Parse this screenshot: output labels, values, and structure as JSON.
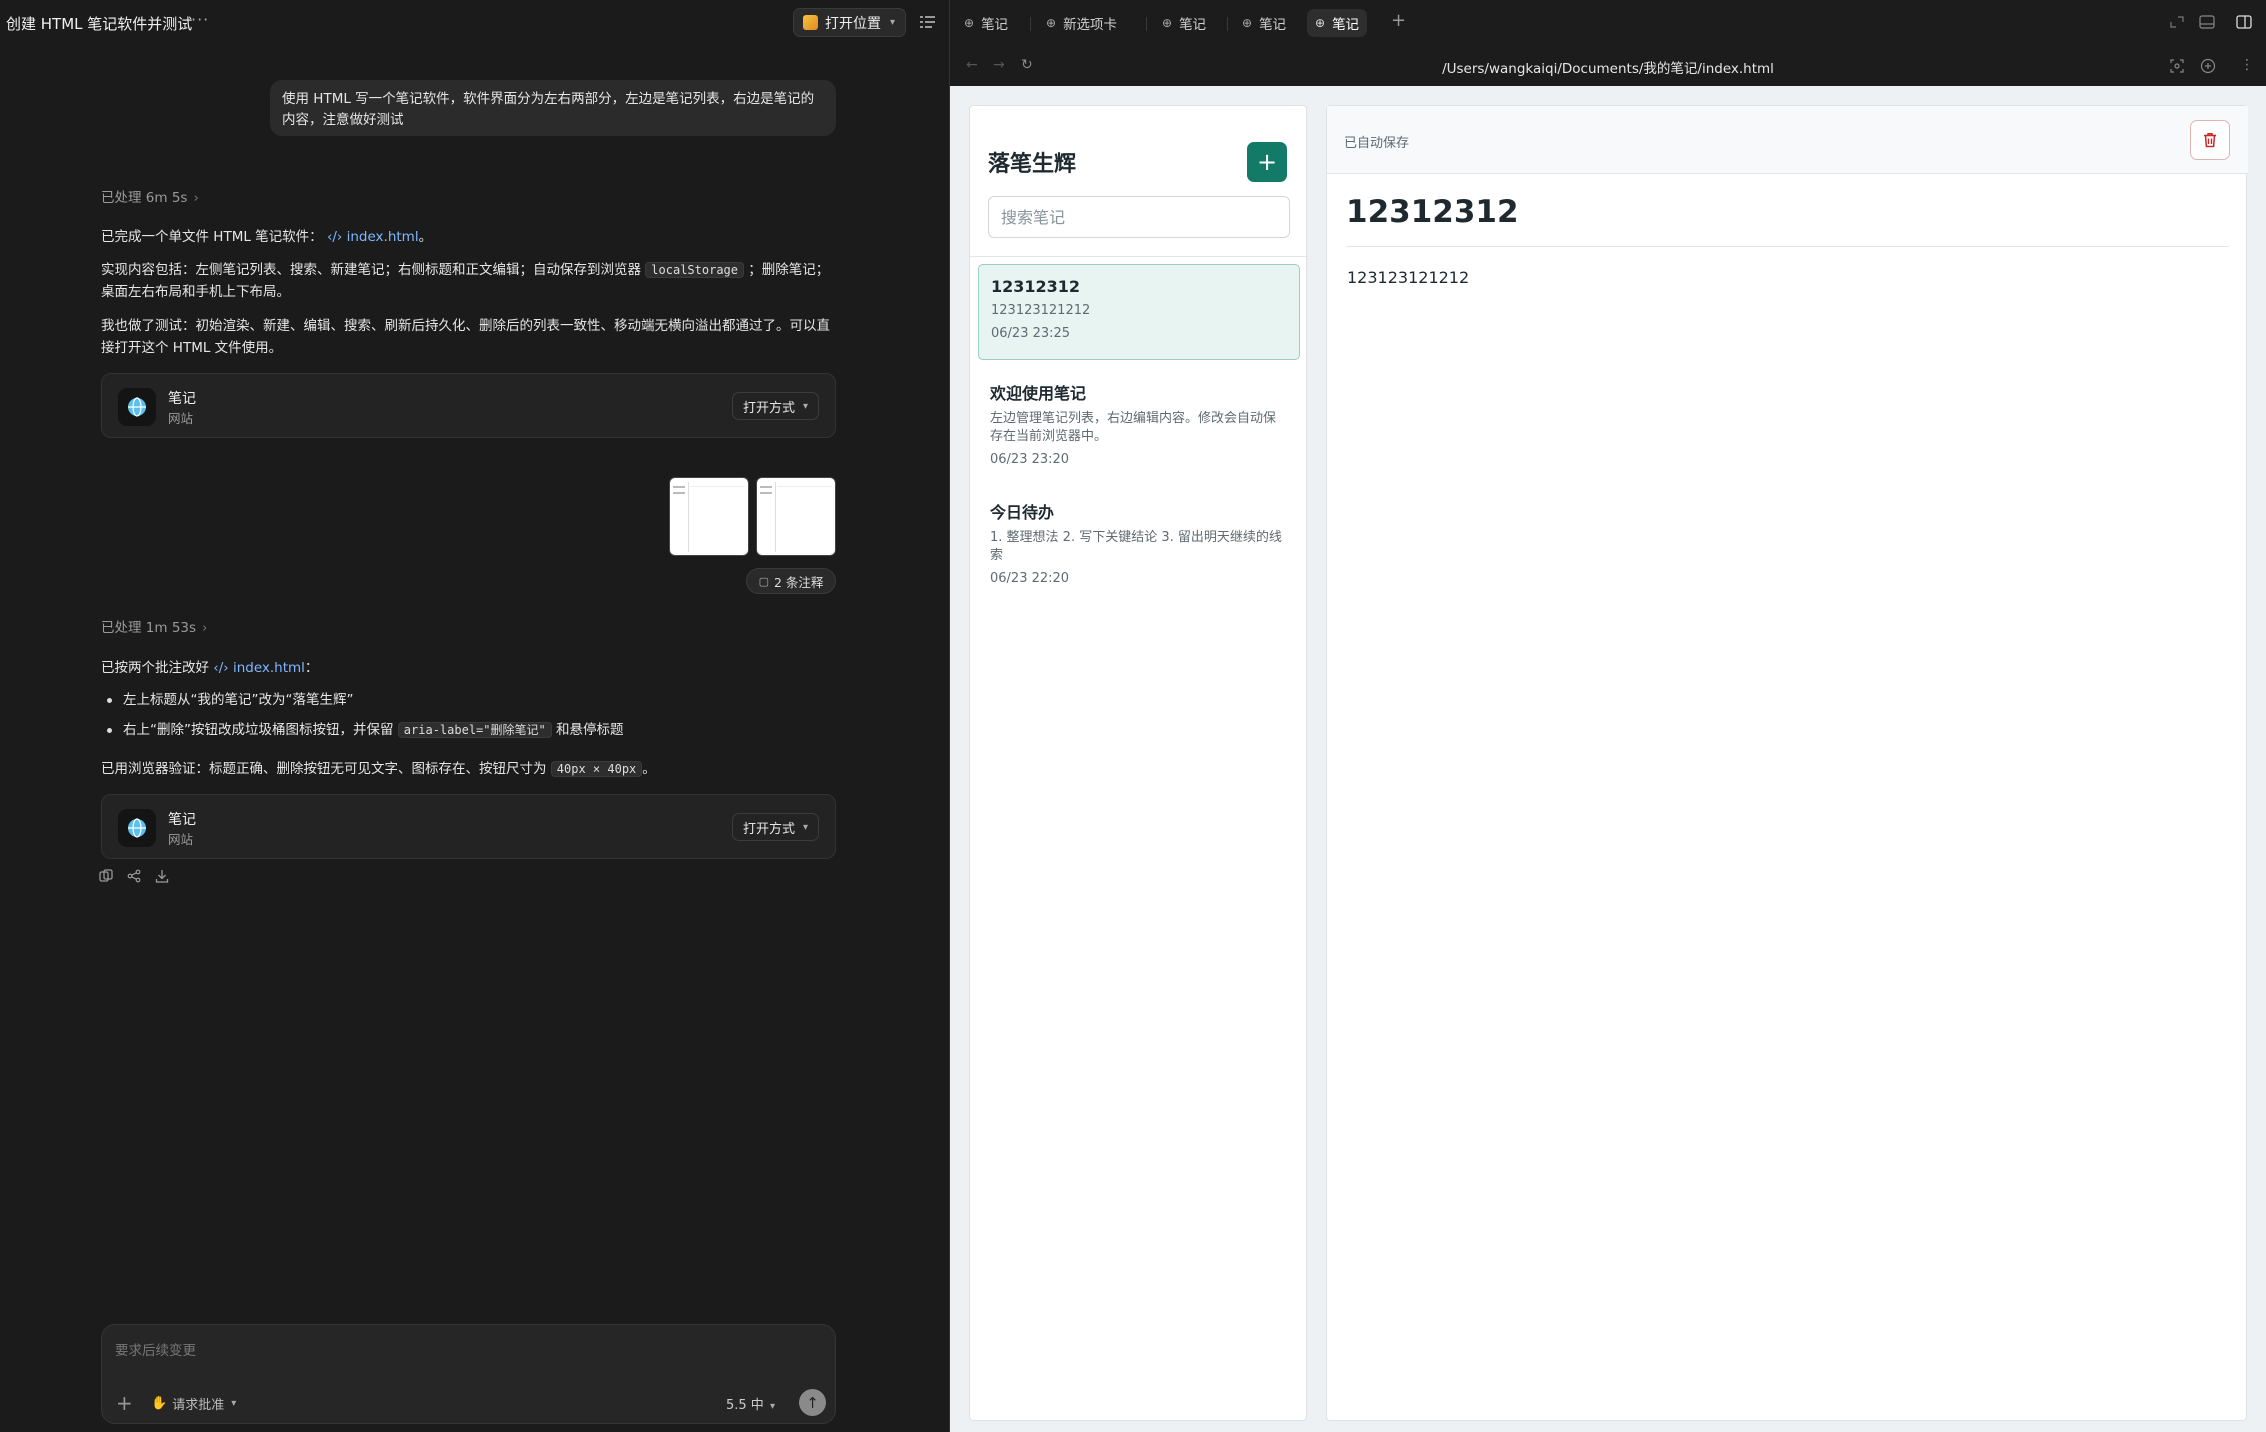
{
  "chat": {
    "title": "创建 HTML 笔记软件并测试",
    "more": "···",
    "open_location": "打开位置",
    "user_message": "使用 HTML 写一个笔记软件，软件界面分为左右两部分，左边是笔记列表，右边是笔记的内容，注意做好测试",
    "processed_1": "已处理 6m 5s",
    "reply1_a_pre": "已完成一个单文件 HTML 笔记软件：",
    "reply1_a_link": "index.html",
    "reply1_a_post": "。",
    "reply1_b_pre": "实现内容包括：左侧笔记列表、搜索、新建笔记；右侧标题和正文编辑；自动保存到浏览器",
    "reply1_b_code": "localStorage",
    "reply1_b_post": "；删除笔记；桌面左右布局和手机上下布局。",
    "reply1_c": "我也做了测试：初始渲染、新建、编辑、搜索、刷新后持久化、删除后的列表一致性、移动端无横向溢出都通过了。可以直接打开这个 HTML 文件使用。",
    "card1": {
      "name": "笔记",
      "sub": "网站",
      "open_as": "打开方式"
    },
    "annotations": "2 条注释",
    "processed_2": "已处理 1m 53s",
    "reply2_pre": "已按两个批注改好",
    "reply2_link": "index.html",
    "reply2_post": "：",
    "bullet1": "左上标题从“我的笔记”改为“落笔生辉”",
    "bullet2_pre": "右上“删除”按钮改成垃圾桶图标按钮，并保留",
    "bullet2_code": "aria-label=\"删除笔记\"",
    "bullet2_post": "和悬停标题",
    "reply2_verify_pre": "已用浏览器验证：标题正确、删除按钮无可见文字、图标存在、按钮尺寸为",
    "reply2_verify_code": "40px × 40px",
    "reply2_verify_post": "。",
    "card2": {
      "name": "笔记",
      "sub": "网站",
      "open_as": "打开方式"
    },
    "composer": {
      "placeholder": "要求后续变更",
      "approve": "请求批准",
      "model": "5.5 中"
    }
  },
  "browser": {
    "tabs": [
      {
        "label": "笔记",
        "active": false
      },
      {
        "label": "新选项卡",
        "active": false
      },
      {
        "label": "笔记",
        "active": false
      },
      {
        "label": "笔记",
        "active": false
      },
      {
        "label": "笔记",
        "active": true
      }
    ],
    "url": "/Users/wangkaiqi/Documents/我的笔记/index.html"
  },
  "app": {
    "title": "落笔生辉",
    "search_placeholder": "搜索笔记",
    "notes": [
      {
        "title": "12312312",
        "preview": "123123121212",
        "date": "06/23 23:25",
        "active": true
      },
      {
        "title": "欢迎使用笔记",
        "preview": "左边管理笔记列表，右边编辑内容。修改会自动保存在当前浏览器中。",
        "date": "06/23 23:20",
        "active": false
      },
      {
        "title": "今日待办",
        "preview": "1. 整理想法 2. 写下关键结论 3. 留出明天继续的线索",
        "date": "06/23 22:20",
        "active": false
      }
    ],
    "editor": {
      "status": "已自动保存",
      "title": "12312312",
      "body": "123123121212"
    }
  },
  "colors": {
    "accent": "#137a67",
    "delete": "#c62828",
    "active_note_bg": "#e8f4f1"
  }
}
